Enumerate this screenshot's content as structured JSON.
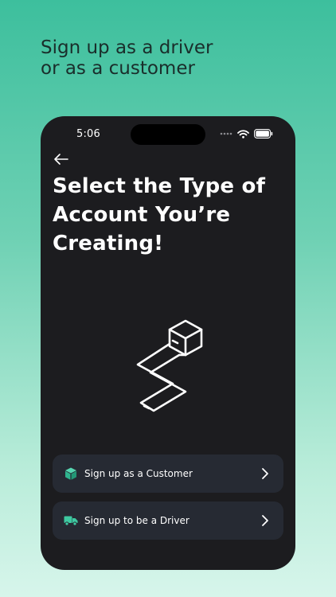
{
  "promo": {
    "line1": "Sign up as a driver",
    "line2": "or as a customer"
  },
  "status_bar": {
    "time": "5:06",
    "icons": [
      "signal-dots-icon",
      "wifi-icon",
      "battery-icon"
    ]
  },
  "screen": {
    "back_icon": "arrow-left-icon",
    "title_line1": "Select the Type of",
    "title_line2": "Account You’re",
    "title_line3": "Creating!",
    "illustration": "isometric-path-box-illustration"
  },
  "options": [
    {
      "label": "Sign up as a Customer",
      "icon": "box-icon",
      "chevron": "chevron-right-icon"
    },
    {
      "label": "Sign up to be a Driver",
      "icon": "truck-icon",
      "chevron": "chevron-right-icon"
    }
  ],
  "colors": {
    "background_top": "#3dbf9d",
    "background_bottom": "#d7f5eb",
    "phone_bg": "#1c1c1f",
    "card_bg": "#262a33",
    "accent": "#3ec9a1",
    "text_light": "#ffffff",
    "headline_text": "#1a2e2b"
  }
}
